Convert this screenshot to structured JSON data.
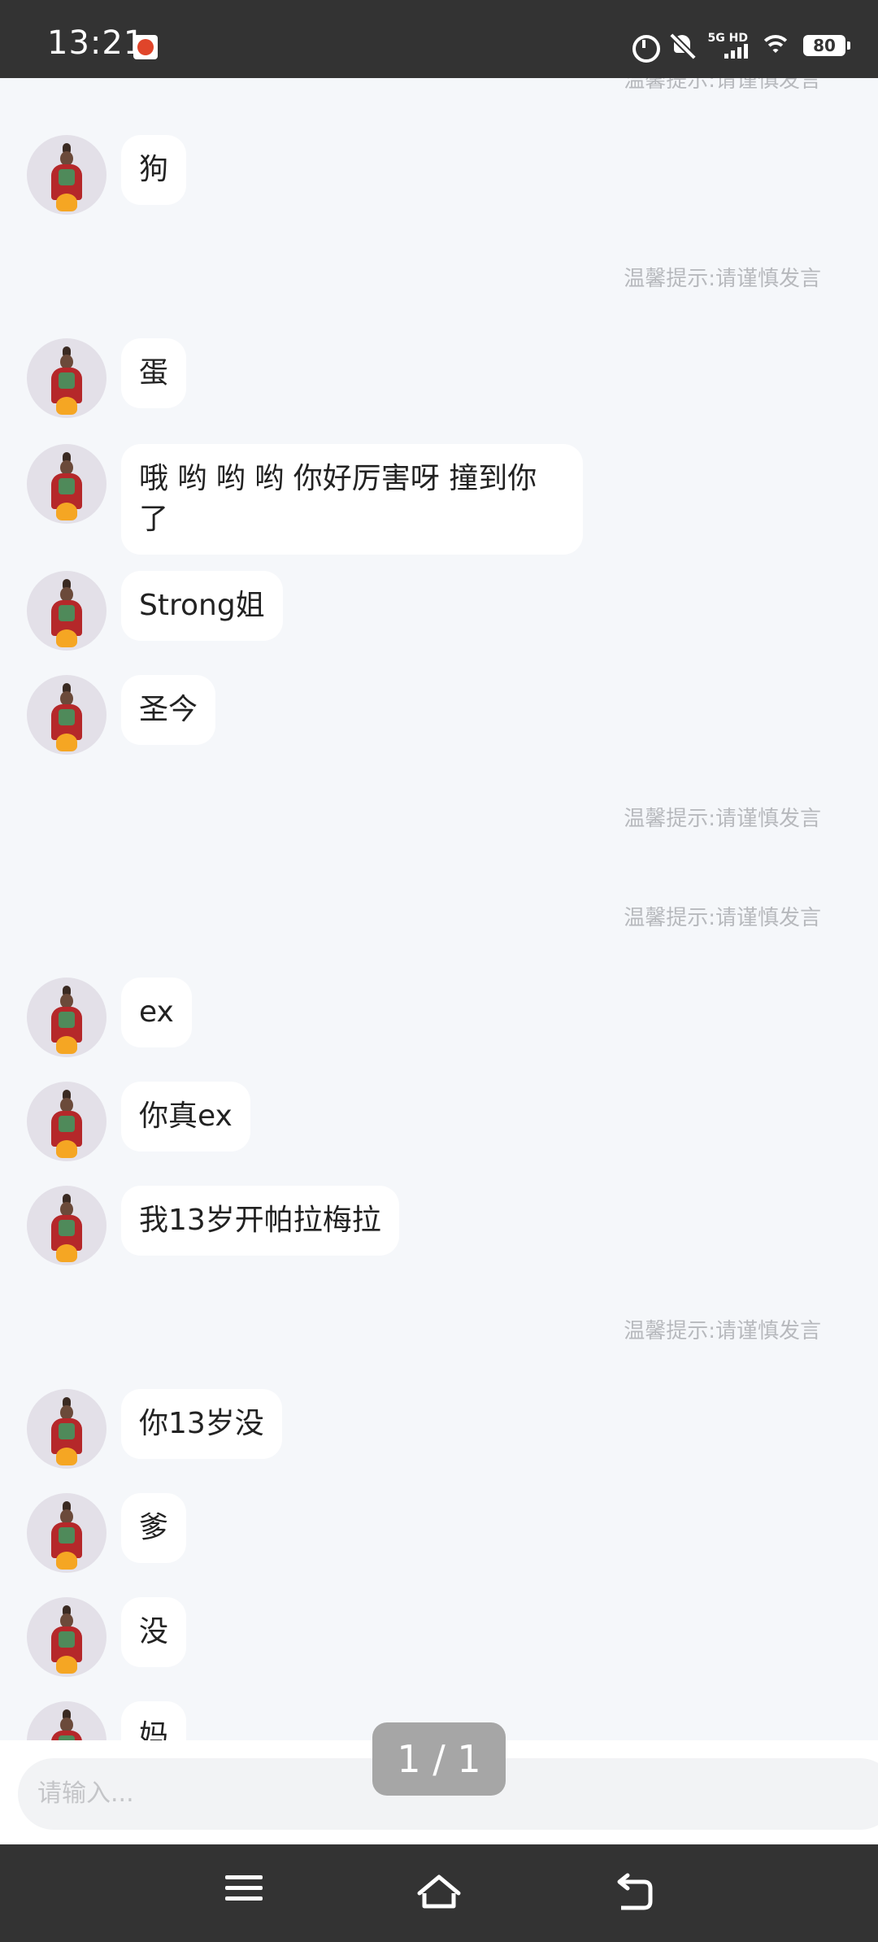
{
  "status_bar": {
    "time": "13:21",
    "network_label": "5G HD",
    "battery": "80"
  },
  "notice_text": "温馨提示:请谨慎发言",
  "messages": [
    {
      "text": "狗"
    },
    {
      "text": "蛋"
    },
    {
      "text": "哦 哟 哟 哟 你好厉害呀 撞到你了"
    },
    {
      "text": "Strong姐"
    },
    {
      "text": "圣今"
    },
    {
      "text": "ex"
    },
    {
      "text": "你真ex"
    },
    {
      "text": "我13岁开帕拉梅拉"
    },
    {
      "text": "你13岁没"
    },
    {
      "text": "爹"
    },
    {
      "text": "没"
    },
    {
      "text": "妈"
    }
  ],
  "input": {
    "placeholder": "请输入..."
  },
  "page_indicator": "1 / 1",
  "icons": {
    "status_app": "app-notification-icon",
    "alarm": "alarm-icon",
    "mute": "mute-icon",
    "wifi": "wifi-icon",
    "nav_menu": "menu-icon",
    "nav_home": "home-icon",
    "nav_back": "back-icon"
  }
}
